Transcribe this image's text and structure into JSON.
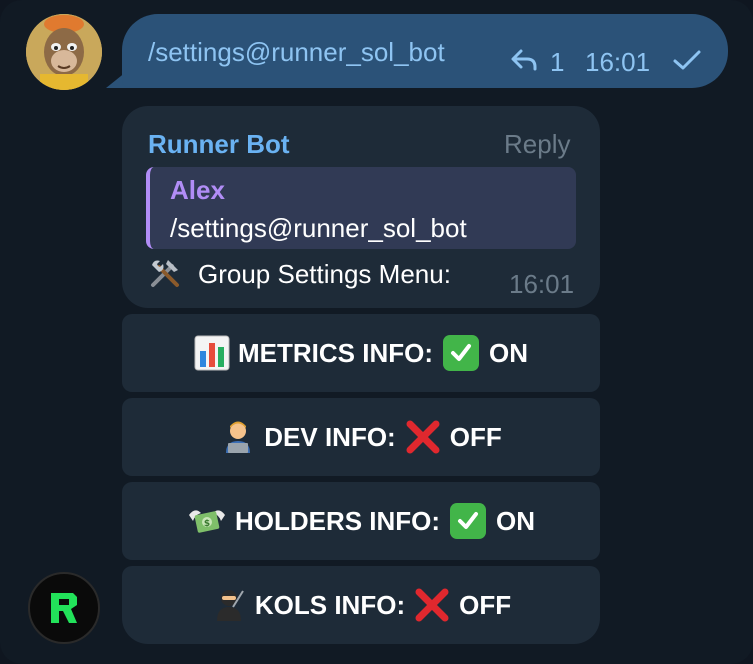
{
  "outgoing_message": {
    "text": "/settings@runner_sol_bot",
    "reply_count": "1",
    "time": "16:01",
    "status_icon": "read-check-icon",
    "colors": {
      "bubble": "#2b5278",
      "text": "#8ec4f2"
    }
  },
  "bot_message": {
    "sender": "Runner Bot",
    "reply_label": "Reply",
    "quote": {
      "name": "Alex",
      "text": "/settings@runner_sol_bot"
    },
    "emoji_icon": "hammer-and-wrench-icon",
    "text": "Group Settings Menu:",
    "time": "16:01",
    "colors": {
      "bubble": "#1e2b38",
      "sender": "#6ab2f2",
      "quote_accent": "#b18df6"
    }
  },
  "keyboard": {
    "buttons": [
      {
        "icon": "bar-chart-icon",
        "label": "METRICS INFO:",
        "status_icon": "check-mark-button-icon",
        "status": "ON"
      },
      {
        "icon": "technologist-icon",
        "label": "DEV INFO:",
        "status_icon": "cross-mark-icon",
        "status": "OFF"
      },
      {
        "icon": "money-with-wings-icon",
        "label": "HOLDERS INFO:",
        "status_icon": "check-mark-button-icon",
        "status": "ON"
      },
      {
        "icon": "ninja-icon",
        "label": "KOLS INFO:",
        "status_icon": "cross-mark-icon",
        "status": "OFF"
      }
    ]
  },
  "avatars": {
    "user": "ape-avatar-icon",
    "bot": "runner-logo-icon"
  },
  "colors": {
    "background": "#111a24",
    "muted_text": "#6b7b89",
    "on_green": "#42b549",
    "off_red": "#e0282e"
  }
}
